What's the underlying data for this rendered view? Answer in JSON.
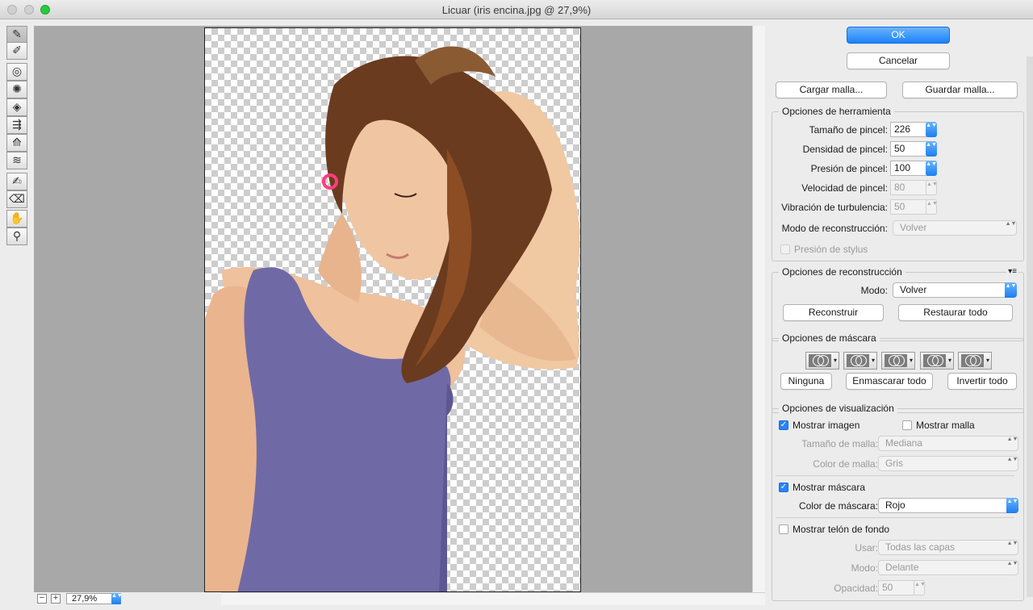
{
  "window": {
    "title": "Licuar (iris encina.jpg @ 27,9%)"
  },
  "tools": [
    {
      "name": "forward-warp-tool",
      "glyph": "✎"
    },
    {
      "name": "reconstruct-tool",
      "glyph": "✐"
    },
    {
      "name": "twirl-tool",
      "glyph": "◎"
    },
    {
      "name": "pucker-tool",
      "glyph": "✺"
    },
    {
      "name": "bloat-tool",
      "glyph": "◈"
    },
    {
      "name": "push-left-tool",
      "glyph": "⇶"
    },
    {
      "name": "mirror-tool",
      "glyph": "⟰"
    },
    {
      "name": "turbulence-tool",
      "glyph": "≋"
    },
    {
      "name": "freeze-mask-tool",
      "glyph": "✍"
    },
    {
      "name": "thaw-mask-tool",
      "glyph": "⌫"
    },
    {
      "name": "hand-tool",
      "glyph": "✋"
    },
    {
      "name": "zoom-tool",
      "glyph": "⚲"
    }
  ],
  "zoom": {
    "minus": "−",
    "plus": "+",
    "value": "27,9%"
  },
  "buttons": {
    "ok": "OK",
    "cancel": "Cancelar",
    "load_mesh": "Cargar malla...",
    "save_mesh": "Guardar malla..."
  },
  "tool_options": {
    "title": "Opciones de herramienta",
    "brush_size_label": "Tamaño de pincel:",
    "brush_size": "226",
    "brush_density_label": "Densidad de pincel:",
    "brush_density": "50",
    "brush_pressure_label": "Presión de pincel:",
    "brush_pressure": "100",
    "brush_rate_label": "Velocidad de pincel:",
    "brush_rate": "80",
    "turbulent_jitter_label": "Vibración de turbulencia:",
    "turbulent_jitter": "50",
    "reconstruct_mode_label": "Modo de reconstrucción:",
    "reconstruct_mode": "Volver",
    "stylus_pressure_label": "Presión de stylus"
  },
  "reconstruct_options": {
    "title": "Opciones de reconstrucción",
    "menu_glyph": "▾≡",
    "mode_label": "Modo:",
    "mode": "Volver",
    "reconstruct": "Reconstruir",
    "restore_all": "Restaurar todo"
  },
  "mask_options": {
    "title": "Opciones de máscara",
    "none": "Ninguna",
    "mask_all": "Enmascarar todo",
    "invert_all": "Invertir todo"
  },
  "view_options": {
    "title": "Opciones de visualización",
    "show_image": "Mostrar imagen",
    "show_mesh": "Mostrar malla",
    "mesh_size_label": "Tamaño de malla:",
    "mesh_size": "Mediana",
    "mesh_color_label": "Color de malla:",
    "mesh_color": "Gris",
    "show_mask": "Mostrar máscara",
    "mask_color_label": "Color de máscara:",
    "mask_color": "Rojo",
    "show_backdrop": "Mostrar telón de fondo",
    "use_label": "Usar:",
    "use": "Todas las capas",
    "mode_label": "Modo:",
    "mode": "Delante",
    "opacity_label": "Opacidad:",
    "opacity": "50"
  },
  "glyphs": {
    "check": "✓",
    "updown": "▲▼"
  }
}
